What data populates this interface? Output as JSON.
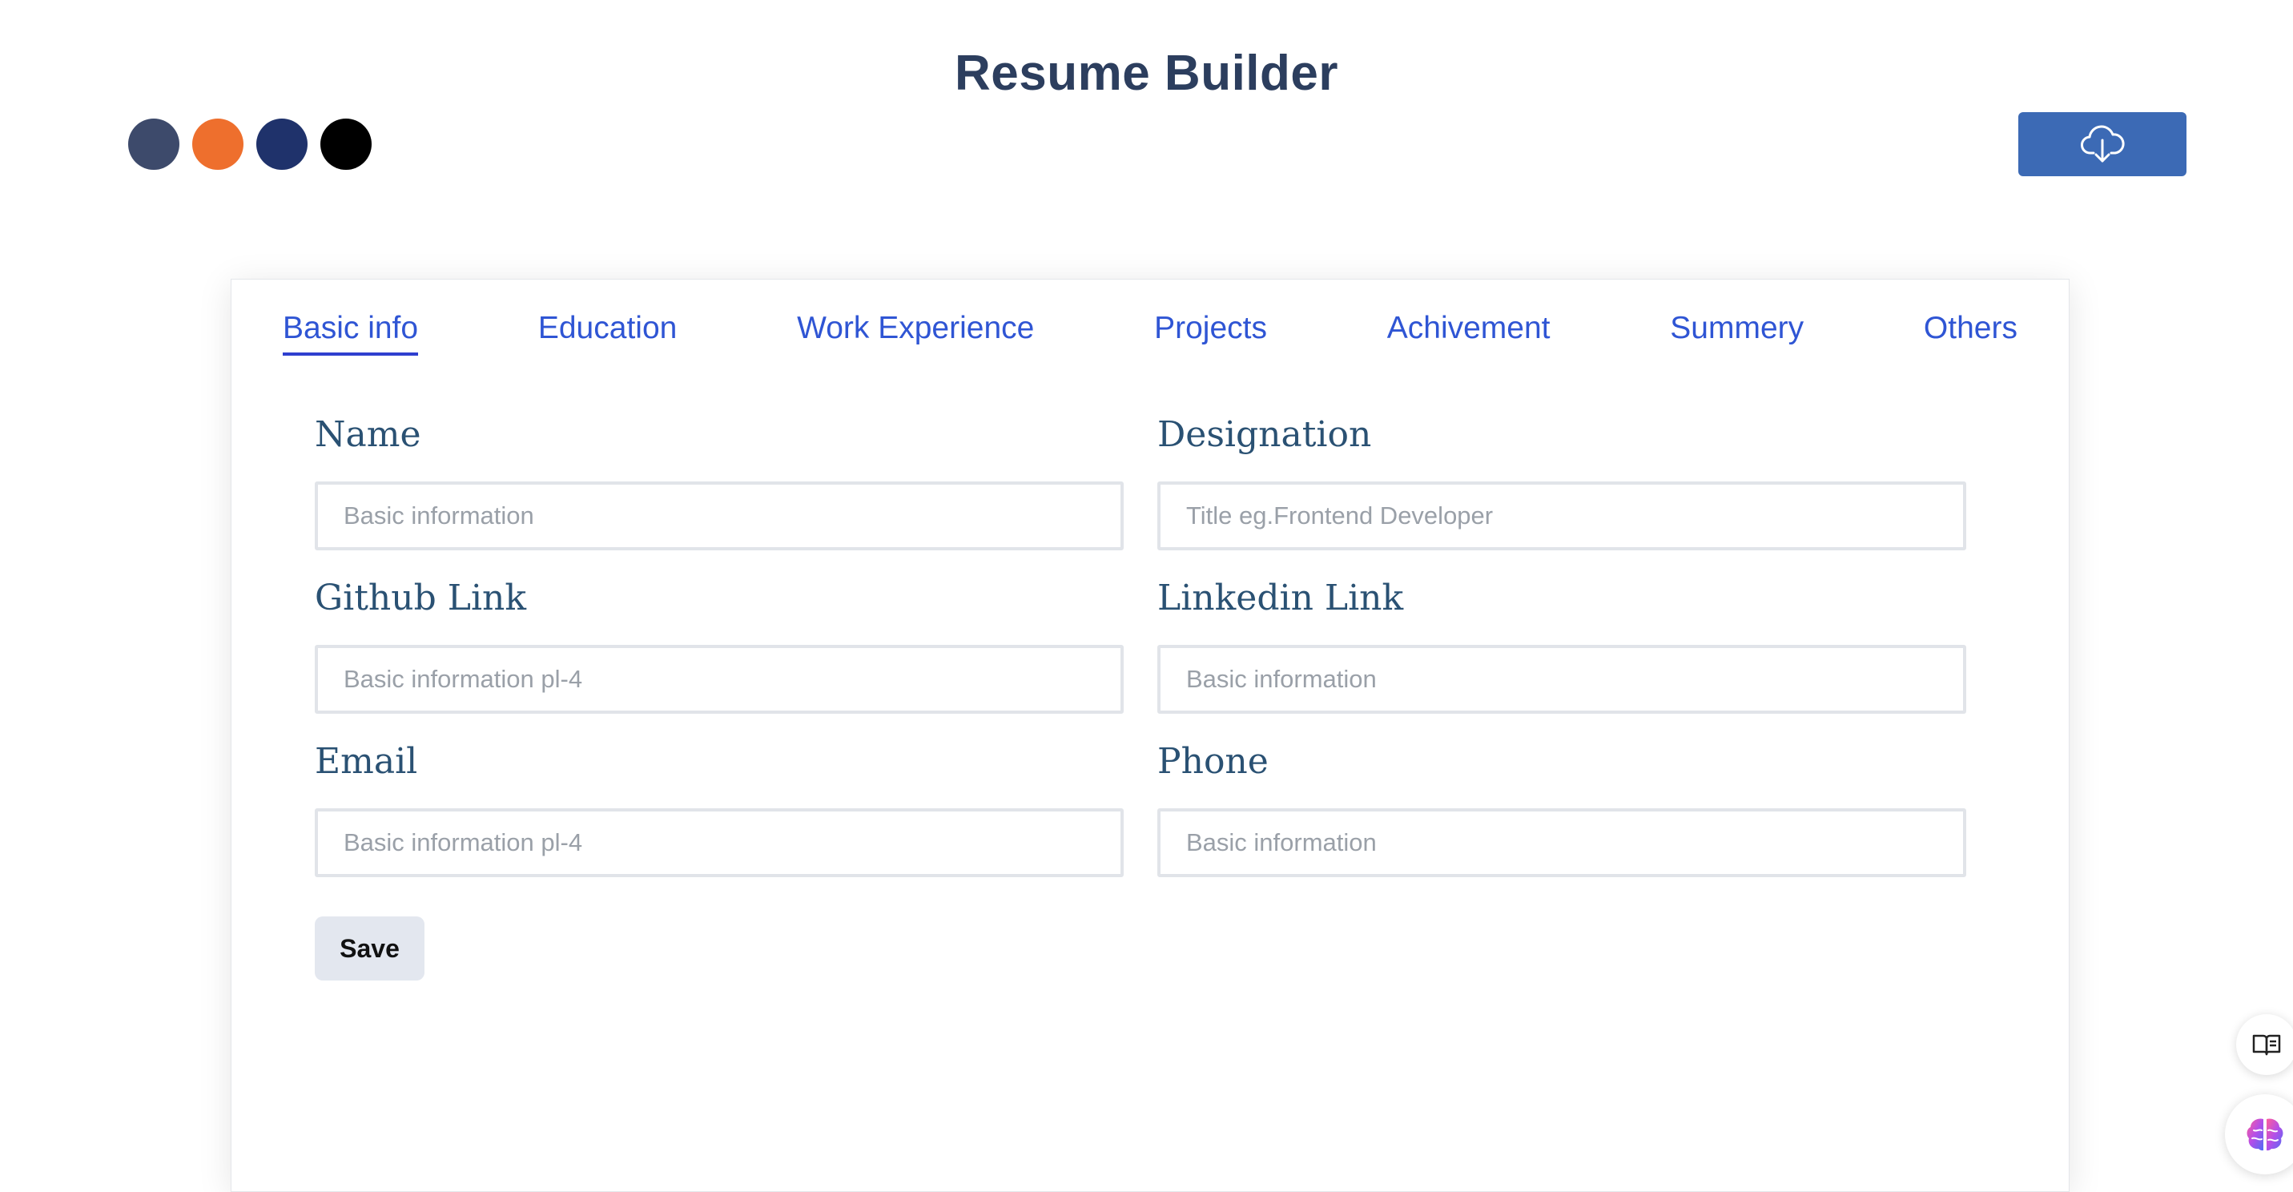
{
  "header": {
    "title": "Resume Builder",
    "download_icon": "cloud-download-icon"
  },
  "theme_swatches": [
    {
      "name": "slate",
      "color": "#3d4a6b"
    },
    {
      "name": "orange",
      "color": "#ee6f2d"
    },
    {
      "name": "navy",
      "color": "#1f326b"
    },
    {
      "name": "black",
      "color": "#000000"
    }
  ],
  "colors": {
    "accent": "#3c6ab5",
    "tab_text": "#2f55d4",
    "label_text": "#2a5173",
    "title_text": "#2c3e5e"
  },
  "tabs": [
    {
      "label": "Basic info",
      "active": true
    },
    {
      "label": "Education",
      "active": false
    },
    {
      "label": "Work Experience",
      "active": false
    },
    {
      "label": "Projects",
      "active": false
    },
    {
      "label": "Achivement",
      "active": false
    },
    {
      "label": "Summery",
      "active": false
    },
    {
      "label": "Others",
      "active": false
    }
  ],
  "form": {
    "fields": [
      {
        "label": "Name",
        "placeholder": "Basic information",
        "value": ""
      },
      {
        "label": "Designation",
        "placeholder": "Title eg.Frontend Developer",
        "value": ""
      },
      {
        "label": "Github Link",
        "placeholder": "Basic information pl-4",
        "value": ""
      },
      {
        "label": "Linkedin Link",
        "placeholder": "Basic information",
        "value": ""
      },
      {
        "label": "Email",
        "placeholder": "Basic information pl-4",
        "value": ""
      },
      {
        "label": "Phone",
        "placeholder": "Basic information",
        "value": ""
      }
    ],
    "save_label": "Save"
  },
  "side_widgets": [
    {
      "icon": "book-icon"
    },
    {
      "icon": "brain-icon"
    }
  ]
}
